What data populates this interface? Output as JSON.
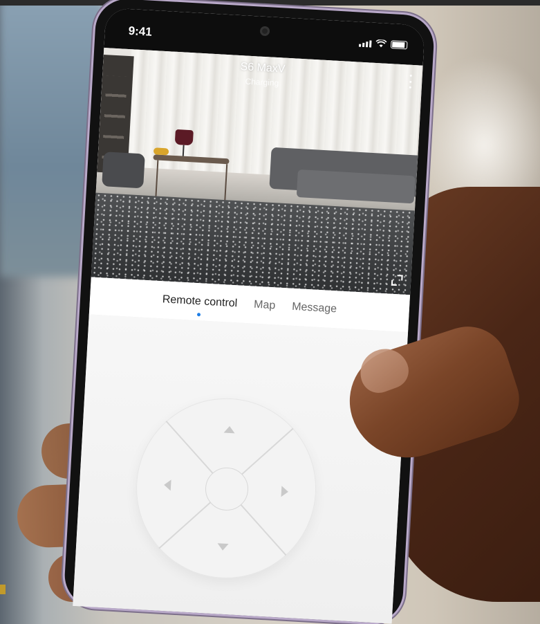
{
  "status_bar": {
    "time": "9:41",
    "icons": [
      "signal-icon",
      "wifi-icon",
      "battery-icon"
    ]
  },
  "device": {
    "name": "S6 MaxV",
    "status": "Charging"
  },
  "tabs": [
    {
      "label": "Remote control",
      "active": true
    },
    {
      "label": "Map",
      "active": false
    },
    {
      "label": "Message",
      "active": false
    }
  ],
  "remote": {
    "controls": [
      "up-arrow-icon",
      "down-arrow-icon",
      "left-arrow-icon",
      "right-arrow-icon",
      "center-button"
    ]
  },
  "colors": {
    "active_tab_indicator": "#1e7ee6"
  }
}
